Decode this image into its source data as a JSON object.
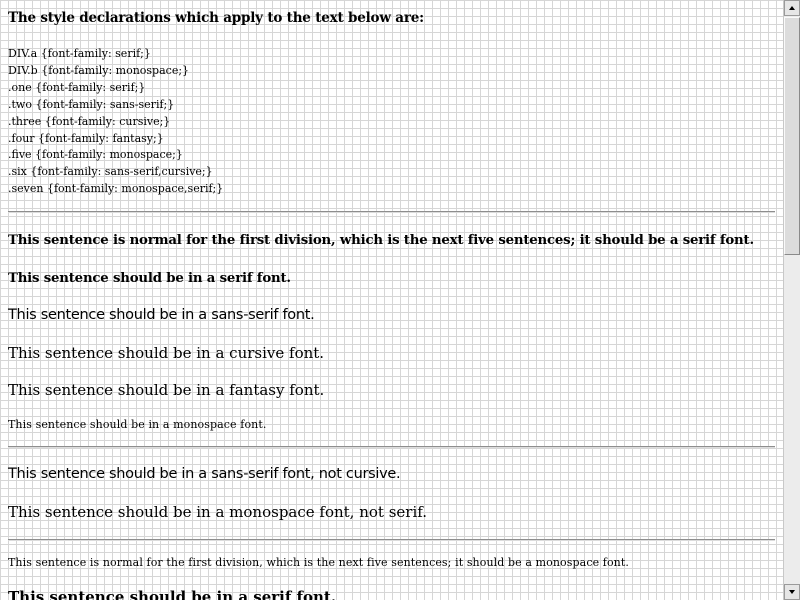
{
  "heading": "The style declarations which apply to the text below are:",
  "rules": [
    "DIV.a {font-family: serif;}",
    "DIV.b {font-family: monospace;}",
    ".one {font-family: serif;}",
    ".two {font-family: sans-serif;}",
    ".three {font-family: cursive;}",
    ".four {font-family: fantasy;}",
    ".five {font-family: monospace;}",
    ".six {font-family: sans-serif,cursive;}",
    ".seven {font-family: monospace,serif;}"
  ],
  "division_a": {
    "normal": "This sentence is normal for the first division, which is the next five sentences; it should be a serif font.",
    "one": "This sentence should be in a serif font.",
    "two": "This sentence should be in a sans-serif font.",
    "three": "This sentence should be in a cursive font.",
    "four": "This sentence should be in a fantasy font.",
    "five": "This sentence should be in a monospace font."
  },
  "middle": {
    "six": "This sentence should be in a sans-serif font, not cursive.",
    "seven": "This sentence should be in a monospace font, not serif."
  },
  "division_b": {
    "normal": "This sentence is normal for the first division, which is the next five sentences; it should be a monospace font.",
    "one": "This sentence should be in a serif font."
  },
  "scrollbar": {
    "position": 0
  }
}
